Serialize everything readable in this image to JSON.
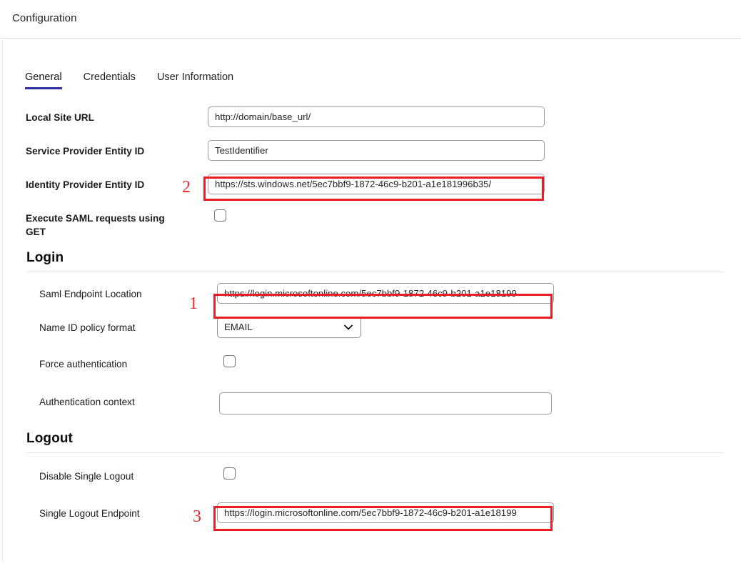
{
  "header": {
    "title": "Configuration"
  },
  "tabs": [
    {
      "label": "General",
      "active": true
    },
    {
      "label": "Credentials",
      "active": false
    },
    {
      "label": "User Information",
      "active": false
    }
  ],
  "general": {
    "local_site_url": {
      "label": "Local Site URL",
      "value": "http://domain/base_url/"
    },
    "sp_entity_id": {
      "label": "Service Provider Entity ID",
      "value": "TestIdentifier"
    },
    "idp_entity_id": {
      "label": "Identity Provider Entity ID",
      "value": "https://sts.windows.net/5ec7bbf9-1872-46c9-b201-a1e181996b35/",
      "marker": "2"
    },
    "execute_saml_get": {
      "label": "Execute SAML requests using GET",
      "checked": false
    }
  },
  "login": {
    "title": "Login",
    "saml_endpoint": {
      "label": "Saml Endpoint Location",
      "value": "https://login.microsoftonline.com/5ec7bbf9-1872-46c9-b201-a1e18199",
      "marker": "1"
    },
    "name_id_policy": {
      "label": "Name ID policy format",
      "value": "EMAIL",
      "chevron": "⌄"
    },
    "force_authentication": {
      "label": "Force authentication",
      "checked": false
    },
    "authentication_context": {
      "label": "Authentication context",
      "value": ""
    }
  },
  "logout": {
    "title": "Logout",
    "disable_single_logout": {
      "label": "Disable Single Logout",
      "checked": false
    },
    "single_logout_endpoint": {
      "label": "Single Logout Endpoint",
      "value": "https://login.microsoftonline.com/5ec7bbf9-1872-46c9-b201-a1e18199",
      "marker": "3"
    }
  },
  "colors": {
    "accent": "#2e2ea8",
    "annotation": "#ec1c24",
    "border": "#9a9aa5"
  }
}
